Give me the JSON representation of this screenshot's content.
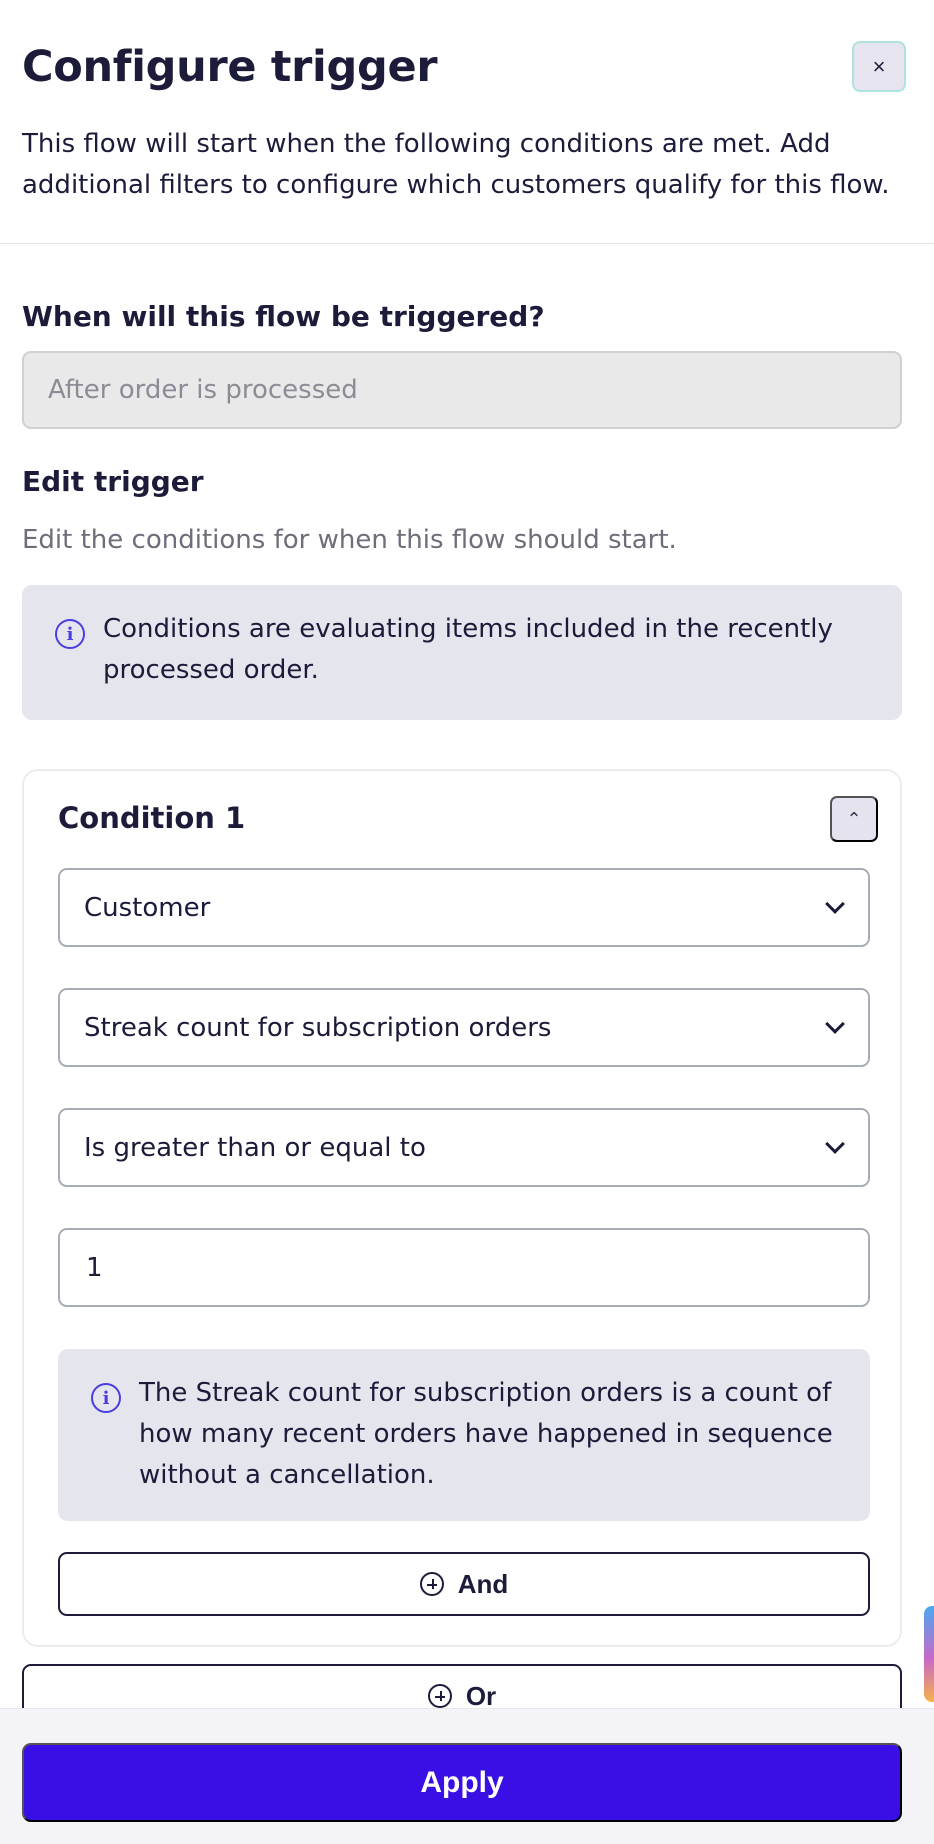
{
  "header": {
    "title": "Configure trigger",
    "close_label": "×",
    "description": "This flow will start when the following conditions are met. Add additional filters to configure which customers qualify for this flow."
  },
  "trigger": {
    "question": "When will this flow be triggered?",
    "value": "After order is processed"
  },
  "edit": {
    "heading": "Edit trigger",
    "subtext": "Edit the conditions for when this flow should start.",
    "info": "Conditions are evaluating items included in the recently processed order."
  },
  "condition": {
    "title": "Condition 1",
    "collapse_icon": "chevron-up-icon",
    "entity": "Customer",
    "property": "Streak count for subscription orders",
    "operator": "Is greater than or equal to",
    "value": "1",
    "info": "The Streak count for subscription orders is a count of how many recent orders have happened in sequence without a cancellation.",
    "and_label": "And"
  },
  "or_label": "Or",
  "footer": {
    "apply_label": "Apply"
  },
  "colors": {
    "primary": "#3a0fe6",
    "info_background": "#e5e5ee",
    "text": "#1c1c3a"
  }
}
